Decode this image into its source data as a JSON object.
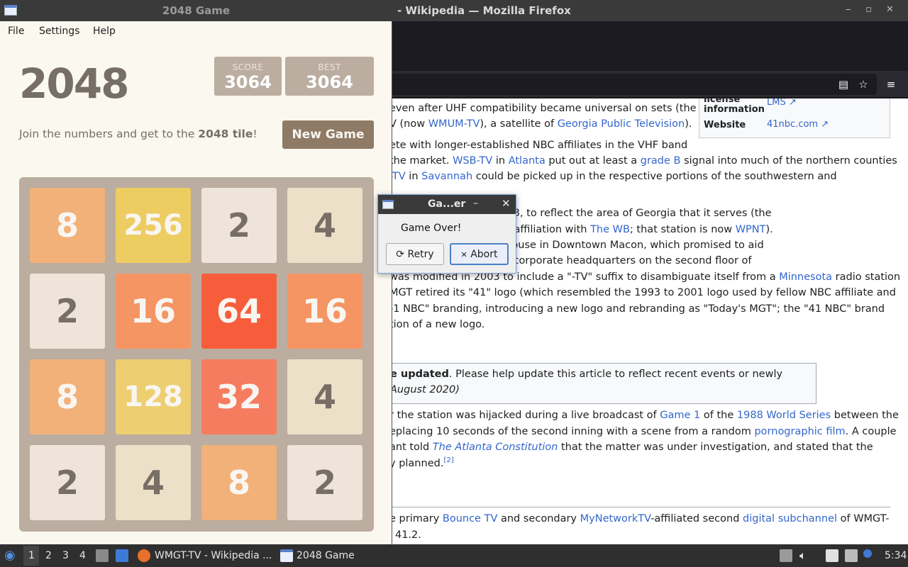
{
  "firefox": {
    "title": "- Wikipedia — Mozilla Firefox",
    "infobox": {
      "license_key": "license information",
      "license_value": "LMS",
      "website_key": "Website",
      "website_value": "41nbc.com"
    },
    "article": {
      "l1": "even after UHF compatibility became universal on sets (the",
      "l2a": "V (now ",
      "l2b": "WMUM-TV",
      "l2c": "), a satellite of ",
      "l2d": "Georgia Public Television",
      "l2e": ").",
      "l3": "ete with longer-established NBC affiliates in the VHF band",
      "l4a": "the market. ",
      "l4b": "WSB-TV",
      "l4c": " in ",
      "l4d": "Atlanta",
      "l4e": " put out at least a ",
      "l4f": "grade B",
      "l4g": " signal into much of the northern counties",
      "l5a": "-TV",
      "l5b": " in ",
      "l5c": "Savannah",
      "l5d": " could be picked up in the respective portions of the southwestern and",
      "l6": "n\") on December 1, 1983, to reflect the area of Georgia that it serves (the",
      "l7a": "1998 to 2006 during its affiliation with ",
      "l7b": "The WB",
      "l7c": "; that station is now ",
      "l7d": "WPNT",
      "l7e": ").",
      "l8": "ovated two-story warehouse in Downtown Macon, which promised to aid",
      "l9": "on. Morris maintains its corporate headquarters on the second floor of",
      "l10a": "was modified in 2003 to include a \"-TV\" suffix to disambiguate itself from a ",
      "l10b": "Minnesota",
      "l10c": " radio station",
      "l11": "MGT retired its \"41\" logo (which resembled the 1993 to 2001 logo used by fellow NBC affiliate and",
      "l12": "-1 NBC\" branding, introducing a new logo and rebranding as \"Today's MGT\"; the \"41 NBC\" brand",
      "l13": "tion of a new logo.",
      "notice_a": "e updated",
      "notice_b": ". Please help update this article to reflect recent events or newly",
      "notice_c": "August 2020)",
      "l14a": "r the station was hijacked during a live broadcast of ",
      "l14b": "Game 1",
      "l14c": " of the ",
      "l14d": "1988 World Series",
      "l14e": " between the",
      "l15a": "eplacing 10 seconds of the second inning with a scene from a random ",
      "l15b": "pornographic film",
      "l15c": ". A couple",
      "l16a": "ant told ",
      "l16b": "The Atlanta Constitution",
      "l16c": " that the matter was under investigation, and stated that the",
      "l17a": "y planned.",
      "l17b": "[2]",
      "l18a": "e primary ",
      "l18b": "Bounce TV",
      "l18c": " and secondary ",
      "l18d": "MyNetworkTV",
      "l18e": "-affiliated second ",
      "l18f": "digital subchannel",
      "l18g": " of WMGT-",
      "l19": "41.2."
    }
  },
  "game_window": {
    "title": "2048 Game",
    "menu": [
      "File",
      "Settings",
      "Help"
    ],
    "logo": "2048",
    "score_label": "SCORE",
    "score": "3064",
    "best_label": "BEST",
    "best": "3064",
    "intro_a": "Join the numbers and get to the ",
    "intro_b": "2048 tile",
    "intro_c": "!",
    "new_game": "New Game",
    "tiles": [
      [
        "8",
        "256",
        "2",
        "4"
      ],
      [
        "2",
        "16",
        "64",
        "16"
      ],
      [
        "8",
        "128",
        "32",
        "4"
      ],
      [
        "2",
        "4",
        "8",
        "2"
      ]
    ]
  },
  "dialog": {
    "title": "Ga...er",
    "minimize": "–",
    "close": "✕",
    "message": "Game Over!",
    "retry": "Retry",
    "abort": "Abort"
  },
  "taskbar": {
    "workspaces": [
      "1",
      "2",
      "3",
      "4"
    ],
    "task_firefox": "WMGT-TV - Wikipedia ...",
    "task_game": "2048 Game",
    "clock": "5:34"
  },
  "colors": {
    "tile_2": "#eee4da",
    "tile_4": "#ede0c8",
    "tile_8": "#f2b179",
    "tile_16": "#f59563",
    "tile_32": "#f67c5f",
    "tile_64": "#f65e3b",
    "tile_128": "#edcf72",
    "tile_256": "#edcc61"
  }
}
